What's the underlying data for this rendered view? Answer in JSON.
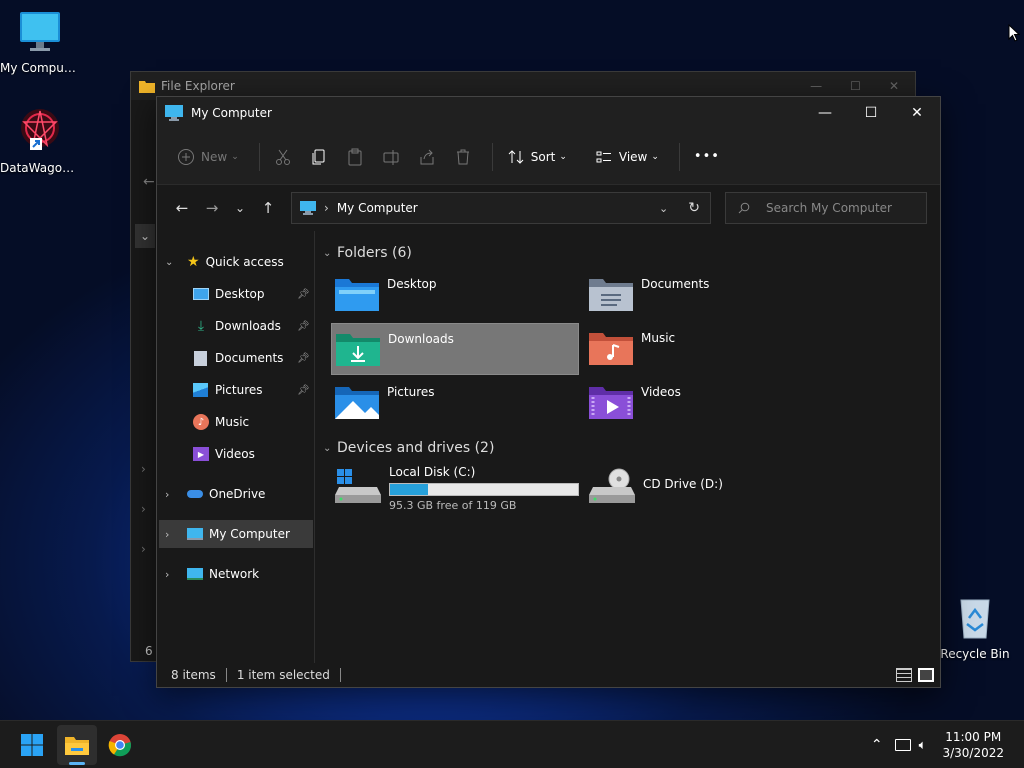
{
  "desktop": {
    "icons": [
      {
        "label": "My Computer",
        "icon": "monitor-icon"
      },
      {
        "label": "DataWagon...",
        "icon": "datawagon-app-icon"
      },
      {
        "label": "Recycle Bin",
        "icon": "recycle-bin-icon"
      }
    ]
  },
  "bg_window": {
    "title": "File Explorer",
    "status": "6 i"
  },
  "window": {
    "title": "My Computer",
    "toolbar": {
      "new_label": "New",
      "sort_label": "Sort",
      "view_label": "View",
      "more_label": "•••"
    },
    "address": {
      "crumb": "My Computer",
      "separator": "›"
    },
    "search": {
      "placeholder": "Search My Computer"
    },
    "sidebar": {
      "quick_access": "Quick access",
      "pinned": [
        {
          "label": "Desktop",
          "icon": "desktop-folder-icon",
          "pinned": true
        },
        {
          "label": "Downloads",
          "icon": "download-icon",
          "pinned": true
        },
        {
          "label": "Documents",
          "icon": "documents-icon",
          "pinned": true
        },
        {
          "label": "Pictures",
          "icon": "pictures-icon",
          "pinned": true
        },
        {
          "label": "Music",
          "icon": "music-icon",
          "pinned": false
        },
        {
          "label": "Videos",
          "icon": "videos-icon",
          "pinned": false
        }
      ],
      "onedrive": "OneDrive",
      "my_computer": "My Computer",
      "network": "Network"
    },
    "folders_header": "Folders (6)",
    "folders": [
      {
        "label": "Desktop",
        "color": "#2f9bf0"
      },
      {
        "label": "Documents",
        "color": "#9aa6b8"
      },
      {
        "label": "Downloads",
        "color": "#1fb58f",
        "selected": true
      },
      {
        "label": "Music",
        "color": "#e8755a"
      },
      {
        "label": "Pictures",
        "color": "#2a8fe8"
      },
      {
        "label": "Videos",
        "color": "#8a4fd8"
      }
    ],
    "drives_header": "Devices and drives (2)",
    "drives": [
      {
        "label": "Local Disk (C:)",
        "free": "95.3 GB free of 119 GB",
        "used_fraction": 0.2
      },
      {
        "label": "CD Drive (D:)"
      }
    ],
    "status": {
      "items": "8 items",
      "selected": "1 item selected"
    }
  },
  "taskbar": {
    "time": "11:00 PM",
    "date": "3/30/2022"
  },
  "colors": {
    "accent": "#0078d4",
    "selection": "#777777",
    "drive_bar": "#26a0da"
  }
}
